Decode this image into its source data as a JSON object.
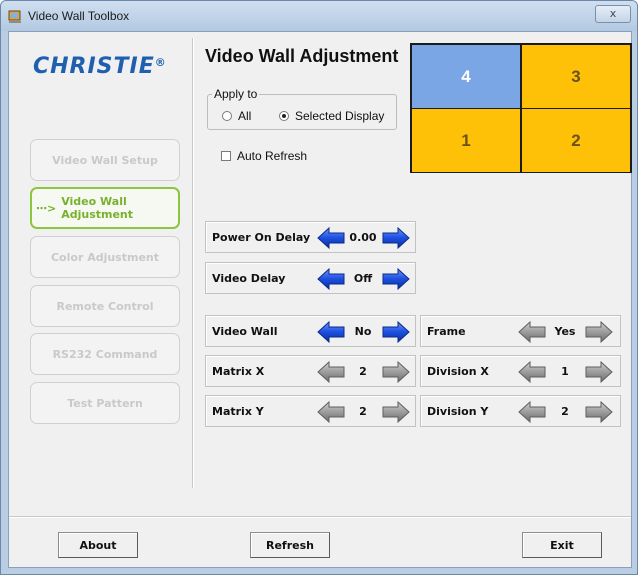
{
  "window": {
    "title": "Video Wall Toolbox",
    "close_glyph": "x"
  },
  "brand": {
    "logo_text": "CHRISTIE",
    "reg_mark": "®"
  },
  "nav": {
    "items": [
      {
        "label": "Video Wall Setup",
        "enabled": false
      },
      {
        "label": "Video Wall Adjustment",
        "enabled": true,
        "active": true,
        "line1": "Video Wall",
        "line2": "Adjustment"
      },
      {
        "label": "Color Adjustment",
        "enabled": false
      },
      {
        "label": "Remote Control",
        "enabled": false
      },
      {
        "label": "RS232 Command",
        "enabled": false
      },
      {
        "label": "Test Pattern",
        "enabled": false
      }
    ]
  },
  "main": {
    "heading": "Video Wall Adjustment",
    "apply_to": {
      "label": "Apply to",
      "options": [
        "All",
        "Selected Display"
      ],
      "selected": "Selected Display"
    },
    "auto_refresh": {
      "label": "Auto Refresh",
      "checked": false
    },
    "wall_grid": {
      "cells": [
        {
          "number": "4",
          "selected": true
        },
        {
          "number": "3",
          "selected": false
        },
        {
          "number": "1",
          "selected": false
        },
        {
          "number": "2",
          "selected": false
        }
      ],
      "colors": {
        "selected": "#7ba6e6",
        "normal": "#ffc107"
      }
    },
    "controls": {
      "power_on_delay": {
        "label": "Power On Delay",
        "value": "0.00",
        "enabled": true
      },
      "video_delay": {
        "label": "Video Delay",
        "value": "Off",
        "enabled": true
      },
      "video_wall": {
        "label": "Video Wall",
        "value": "No",
        "enabled": true
      },
      "frame": {
        "label": "Frame",
        "value": "Yes",
        "enabled": false
      },
      "matrix_x": {
        "label": "Matrix X",
        "value": "2",
        "enabled": false
      },
      "division_x": {
        "label": "Division X",
        "value": "1",
        "enabled": false
      },
      "matrix_y": {
        "label": "Matrix Y",
        "value": "2",
        "enabled": false
      },
      "division_y": {
        "label": "Division Y",
        "value": "2",
        "enabled": false
      }
    }
  },
  "footer": {
    "about": "About",
    "refresh": "Refresh",
    "exit": "Exit"
  },
  "icons": {
    "left": "arrow-left-icon",
    "right": "arrow-right-icon",
    "nav_pointer": "dotted-arrow-icon"
  },
  "colors": {
    "arrow_active": "#1a4fd6",
    "arrow_disabled": "#9a9a9a",
    "nav_active": "#8cc63f"
  }
}
